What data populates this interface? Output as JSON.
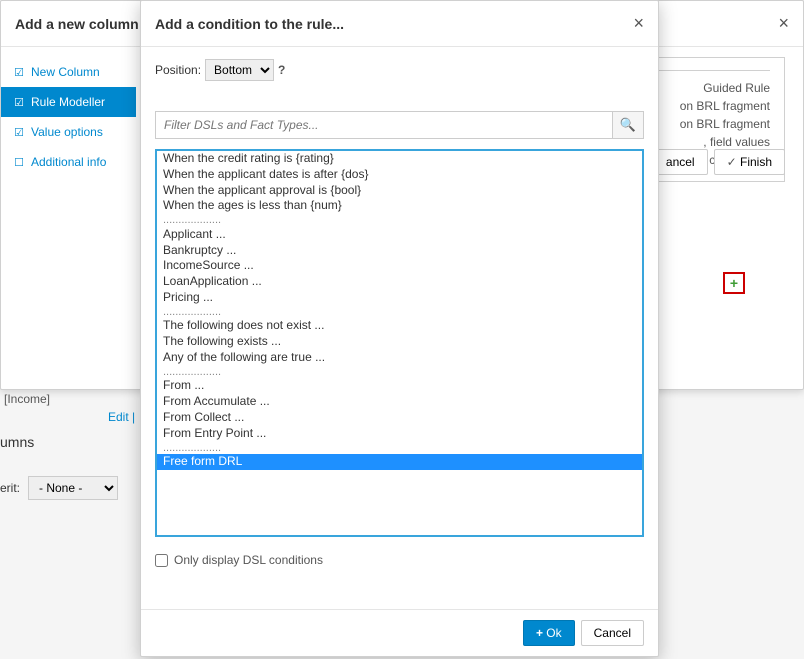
{
  "back_modal": {
    "title": "Add a new column",
    "steps": {
      "new_column": "New Column",
      "rule_modeller": "Rule Modeller",
      "value_options": "Value options",
      "additional_info": "Additional info"
    },
    "info_text_1": "Guided Rule",
    "info_text_2": "on BRL fragment",
    "info_text_3": "on BRL fragment",
    "info_text_4": ", field values",
    "info_text_5": "pes can refer to",
    "add_icon": "+",
    "cancel": "ancel",
    "finish": "Finish"
  },
  "bg": {
    "income": "[Income]",
    "edit": "Edit  |",
    "umns": "umns",
    "erit": "erit:",
    "select_value": "- None -"
  },
  "front_modal": {
    "title": "Add a condition to the rule...",
    "position_label": "Position:",
    "position_value": "Bottom",
    "position_help": "?",
    "search_placeholder": "Filter DSLs and Fact Types...",
    "items": [
      {
        "t": "When the credit rating is {rating}",
        "sel": false
      },
      {
        "t": "When the applicant dates is after {dos}",
        "sel": false
      },
      {
        "t": "When the applicant approval is {bool}",
        "sel": false
      },
      {
        "t": "When the ages is less than {num}",
        "sel": false
      },
      {
        "sep": "..................."
      },
      {
        "t": "Applicant ...",
        "sel": false
      },
      {
        "t": "Bankruptcy ...",
        "sel": false
      },
      {
        "t": "IncomeSource ...",
        "sel": false
      },
      {
        "t": "LoanApplication ...",
        "sel": false
      },
      {
        "t": "Pricing ...",
        "sel": false
      },
      {
        "sep": "..................."
      },
      {
        "t": "The following does not exist ...",
        "sel": false
      },
      {
        "t": "The following exists ...",
        "sel": false
      },
      {
        "t": "Any of the following are true ...",
        "sel": false
      },
      {
        "sep": "..................."
      },
      {
        "t": "From ...",
        "sel": false
      },
      {
        "t": "From Accumulate ...",
        "sel": false
      },
      {
        "t": "From Collect ...",
        "sel": false
      },
      {
        "t": "From Entry Point ...",
        "sel": false
      },
      {
        "sep": "..................."
      },
      {
        "t": "Free form DRL",
        "sel": true
      }
    ],
    "dsl_checkbox_label": "Only display DSL conditions",
    "ok": "Ok",
    "cancel": "Cancel"
  }
}
